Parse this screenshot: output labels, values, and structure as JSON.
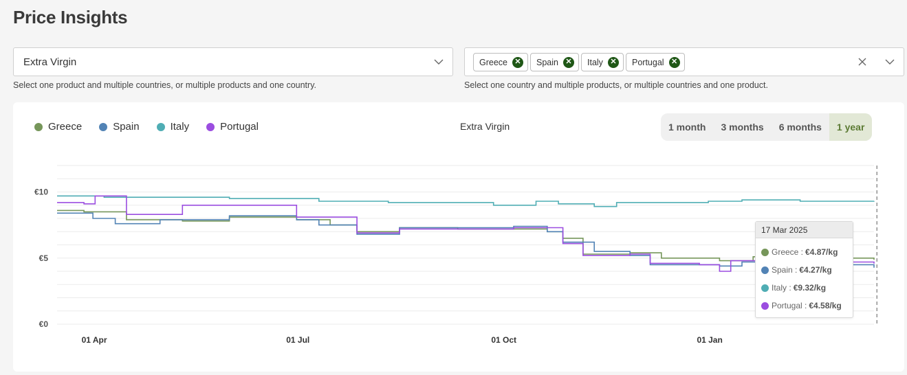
{
  "page": {
    "title": "Price Insights"
  },
  "product_select": {
    "value": "Extra Virgin",
    "helper": "Select one product and multiple countries, or multiple products and one country."
  },
  "country_select": {
    "chips": [
      "Greece",
      "Spain",
      "Italy",
      "Portugal"
    ],
    "helper": "Select one country and multiple products, or multiple countries and one product."
  },
  "colors": {
    "Greece": "#76965a",
    "Spain": "#5283b5",
    "Italy": "#4fadb4",
    "Portugal": "#9b4de0",
    "chip_x": "#1f5716"
  },
  "ranges": [
    "1 month",
    "3 months",
    "6 months",
    "1 year"
  ],
  "active_range": "1 year",
  "tooltip": {
    "date": "17 Mar 2025",
    "rows": [
      {
        "series": "Greece",
        "label": "Greece :",
        "value": "€4.87/kg"
      },
      {
        "series": "Spain",
        "label": "Spain :",
        "value": "€4.27/kg"
      },
      {
        "series": "Italy",
        "label": "Italy :",
        "value": "€9.32/kg"
      },
      {
        "series": "Portugal",
        "label": "Portugal :",
        "value": "€4.58/kg"
      }
    ]
  },
  "chart_data": {
    "type": "line",
    "title": "Extra Virgin",
    "x_tick_labels": [
      "01 Apr",
      "01 Jul",
      "01 Oct",
      "01 Jan"
    ],
    "x_tick_dates": [
      "2024-04-01",
      "2024-07-01",
      "2024-10-01",
      "2025-01-01"
    ],
    "y_tick_labels": [
      "€0",
      "€5",
      "€10"
    ],
    "ylim": [
      0,
      12
    ],
    "xlim": [
      "2024-03-20",
      "2025-03-20"
    ],
    "grid": true,
    "legend": "top-left",
    "hover_date": "2025-03-17",
    "series": [
      {
        "name": "Greece",
        "points": [
          [
            "2024-03-20",
            8.6
          ],
          [
            "2024-04-01",
            8.5
          ],
          [
            "2024-04-20",
            7.9
          ],
          [
            "2024-05-15",
            7.8
          ],
          [
            "2024-06-05",
            8.1
          ],
          [
            "2024-07-05",
            7.9
          ],
          [
            "2024-07-20",
            7.5
          ],
          [
            "2024-08-01",
            7.0
          ],
          [
            "2024-08-20",
            7.3
          ],
          [
            "2024-09-15",
            7.2
          ],
          [
            "2024-10-01",
            7.2
          ],
          [
            "2024-10-25",
            7.0
          ],
          [
            "2024-11-01",
            6.5
          ],
          [
            "2024-11-10",
            5.3
          ],
          [
            "2024-12-01",
            5.4
          ],
          [
            "2024-12-15",
            5.0
          ],
          [
            "2025-01-10",
            4.8
          ],
          [
            "2025-01-25",
            5.1
          ],
          [
            "2025-02-15",
            5.0
          ],
          [
            "2025-03-20",
            4.87
          ]
        ]
      },
      {
        "name": "Spain",
        "points": [
          [
            "2024-03-20",
            8.4
          ],
          [
            "2024-04-05",
            8.0
          ],
          [
            "2024-04-15",
            7.6
          ],
          [
            "2024-05-05",
            7.9
          ],
          [
            "2024-06-05",
            8.2
          ],
          [
            "2024-07-05",
            7.9
          ],
          [
            "2024-07-15",
            7.5
          ],
          [
            "2024-08-01",
            6.8
          ],
          [
            "2024-08-20",
            7.3
          ],
          [
            "2024-09-15",
            7.3
          ],
          [
            "2024-10-10",
            7.4
          ],
          [
            "2024-10-25",
            7.0
          ],
          [
            "2024-11-01",
            6.2
          ],
          [
            "2024-11-15",
            5.5
          ],
          [
            "2024-12-01",
            5.2
          ],
          [
            "2024-12-10",
            4.5
          ],
          [
            "2025-01-10",
            4.4
          ],
          [
            "2025-01-20",
            4.7
          ],
          [
            "2025-02-15",
            4.9
          ],
          [
            "2025-03-05",
            4.5
          ],
          [
            "2025-03-20",
            4.27
          ]
        ]
      },
      {
        "name": "Italy",
        "points": [
          [
            "2024-03-20",
            9.7
          ],
          [
            "2024-04-10",
            9.6
          ],
          [
            "2024-05-15",
            9.6
          ],
          [
            "2024-06-05",
            9.5
          ],
          [
            "2024-07-15",
            9.3
          ],
          [
            "2024-08-15",
            9.2
          ],
          [
            "2024-09-15",
            9.2
          ],
          [
            "2024-10-01",
            9.0
          ],
          [
            "2024-10-20",
            9.3
          ],
          [
            "2024-10-30",
            9.1
          ],
          [
            "2024-11-15",
            8.9
          ],
          [
            "2024-11-25",
            9.2
          ],
          [
            "2024-12-15",
            9.2
          ],
          [
            "2025-01-05",
            9.3
          ],
          [
            "2025-01-20",
            9.4
          ],
          [
            "2025-02-15",
            9.3
          ],
          [
            "2025-03-20",
            9.32
          ]
        ]
      },
      {
        "name": "Portugal",
        "points": [
          [
            "2024-03-20",
            9.2
          ],
          [
            "2024-04-01",
            9.1
          ],
          [
            "2024-04-06",
            9.7
          ],
          [
            "2024-04-20",
            8.3
          ],
          [
            "2024-05-15",
            9.0
          ],
          [
            "2024-06-01",
            9.0
          ],
          [
            "2024-06-25",
            9.0
          ],
          [
            "2024-07-05",
            8.1
          ],
          [
            "2024-07-25",
            8.1
          ],
          [
            "2024-08-01",
            6.9
          ],
          [
            "2024-08-20",
            7.2
          ],
          [
            "2024-09-15",
            7.2
          ],
          [
            "2024-10-10",
            7.3
          ],
          [
            "2024-10-25",
            7.3
          ],
          [
            "2024-11-01",
            6.1
          ],
          [
            "2024-11-10",
            5.2
          ],
          [
            "2024-12-01",
            5.3
          ],
          [
            "2024-12-10",
            4.6
          ],
          [
            "2025-01-01",
            4.5
          ],
          [
            "2025-01-10",
            4.0
          ],
          [
            "2025-01-15",
            4.8
          ],
          [
            "2025-02-20",
            4.7
          ],
          [
            "2025-03-20",
            4.58
          ]
        ]
      }
    ]
  }
}
